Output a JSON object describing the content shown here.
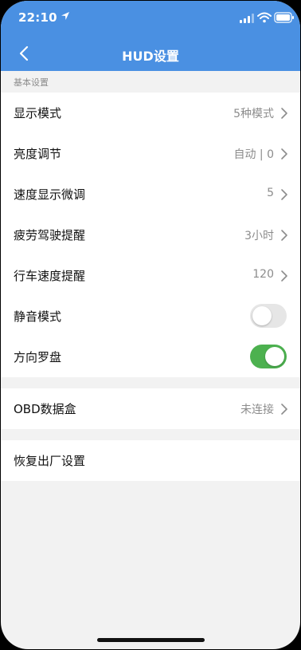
{
  "status_bar": {
    "time": "22:10"
  },
  "header": {
    "title": "HUD设置"
  },
  "sections": {
    "basic_label": "基本设置"
  },
  "basic_settings": [
    {
      "label": "显示模式",
      "value": "5种模式"
    },
    {
      "label": "亮度调节",
      "value": "自动 | 0"
    },
    {
      "label": "速度显示微调",
      "value": "5"
    },
    {
      "label": "疲劳驾驶提醒",
      "value": "3小时"
    },
    {
      "label": "行车速度提醒",
      "value": "120"
    },
    {
      "label": "静音模式",
      "toggle": false
    },
    {
      "label": "方向罗盘",
      "toggle": true
    }
  ],
  "obd": {
    "label": "OBD数据盒",
    "value": "未连接"
  },
  "reset": {
    "label": "恢复出厂设置"
  },
  "colors": {
    "header": "#4a90e2",
    "toggle_on": "#4cb14f",
    "toggle_off": "#e6e6e6",
    "background": "#f2f2f2"
  }
}
